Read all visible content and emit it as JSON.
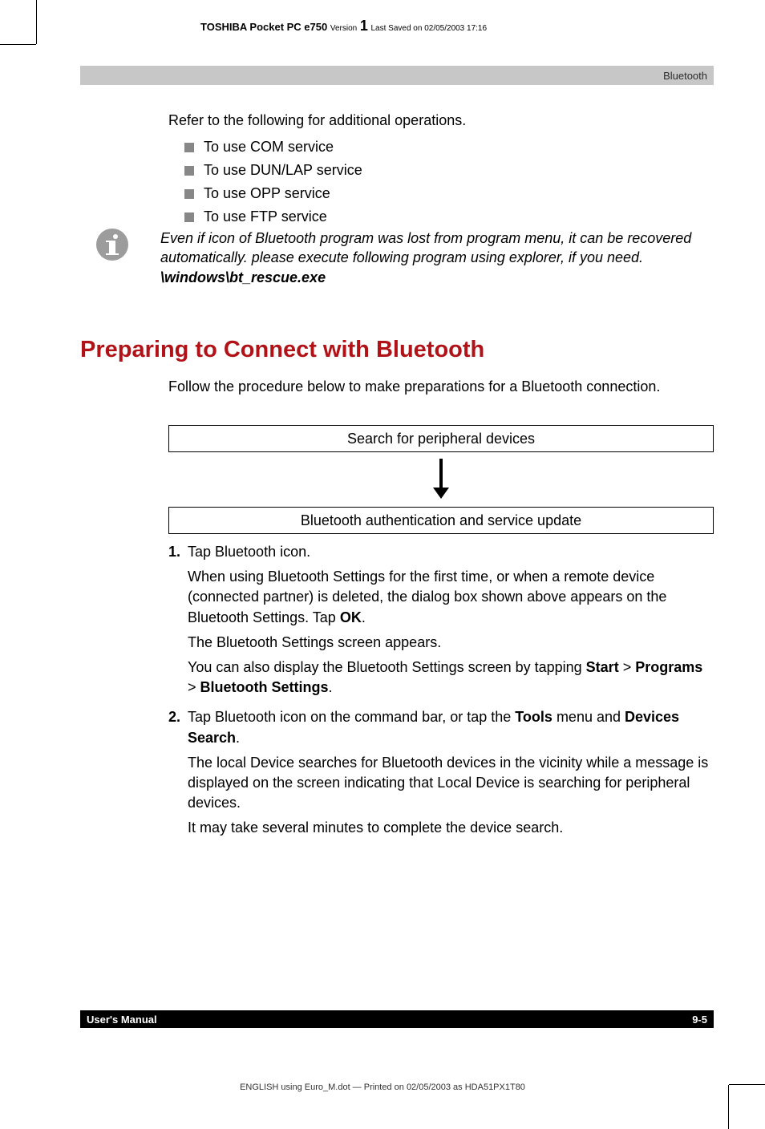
{
  "header": {
    "product": "TOSHIBA Pocket PC e750",
    "version_label": "Version",
    "version_num": "1",
    "saved": "Last Saved on 02/05/2003 17:16"
  },
  "section_bar": {
    "title": "Bluetooth"
  },
  "intro": "Refer to the following for additional operations.",
  "bullets": [
    "To use COM service",
    "To use DUN/LAP service",
    "To use OPP service",
    "To use FTP service"
  ],
  "info_note": {
    "text": "Even if icon of Bluetooth program was lost from program menu, it can be recovered automatically. please execute following program using explorer, if you need.",
    "path": "\\windows\\bt_rescue.exe"
  },
  "heading": "Preparing to Connect with Bluetooth",
  "follow": "Follow the procedure below to make preparations for a Bluetooth connection.",
  "flow": {
    "box1": "Search for peripheral devices",
    "box2": "Bluetooth authentication and service update"
  },
  "steps": [
    {
      "num": "1.",
      "paras": [
        {
          "t": "Tap Bluetooth icon."
        },
        {
          "t": "When using Bluetooth Settings for the first time, or when a remote device (connected partner) is deleted, the dialog box shown above appears on the Bluetooth Settings. Tap ",
          "b1": "OK",
          "t2": "."
        },
        {
          "t": "The Bluetooth Settings screen appears."
        },
        {
          "t": "You can also display the Bluetooth Settings screen by tapping ",
          "b1": "Start",
          "t2": " > ",
          "b2": "Programs",
          "t3": " > ",
          "b3": "Bluetooth Settings",
          "t4": "."
        }
      ]
    },
    {
      "num": "2.",
      "paras": [
        {
          "t": "Tap Bluetooth icon on the command bar, or tap the ",
          "b1": "Tools",
          "t2": " menu and ",
          "b2": "Devices  Search",
          "t3": "."
        },
        {
          "t": "The local Device searches for Bluetooth devices in the vicinity while a message is displayed on the screen indicating that Local Device is searching for peripheral devices."
        },
        {
          "t": "It may take several minutes to complete the device search."
        }
      ]
    }
  ],
  "footer": {
    "left": "User's Manual",
    "right": "9-5"
  },
  "footer_print": "ENGLISH using Euro_M.dot — Printed on 02/05/2003 as HDA51PX1T80"
}
